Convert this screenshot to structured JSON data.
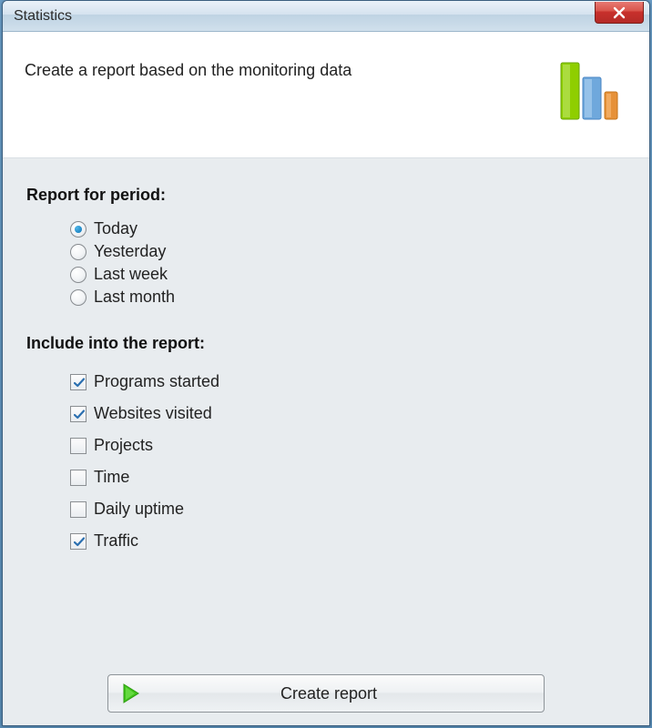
{
  "window": {
    "title": "Statistics"
  },
  "header": {
    "text": "Create a report based on the monitoring data"
  },
  "period": {
    "heading": "Report for period:",
    "options": [
      {
        "label": "Today",
        "selected": true
      },
      {
        "label": "Yesterday",
        "selected": false
      },
      {
        "label": "Last week",
        "selected": false
      },
      {
        "label": "Last month",
        "selected": false
      }
    ]
  },
  "include": {
    "heading": "Include into the report:",
    "options": [
      {
        "label": "Programs started",
        "checked": true
      },
      {
        "label": "Websites visited",
        "checked": true
      },
      {
        "label": "Projects",
        "checked": false
      },
      {
        "label": "Time",
        "checked": false
      },
      {
        "label": "Daily uptime",
        "checked": false
      },
      {
        "label": "Traffic",
        "checked": true
      }
    ]
  },
  "button": {
    "label": "Create report"
  },
  "colors": {
    "bar1": "#8fce00",
    "bar2": "#6fa8dc",
    "bar3": "#e69138"
  }
}
